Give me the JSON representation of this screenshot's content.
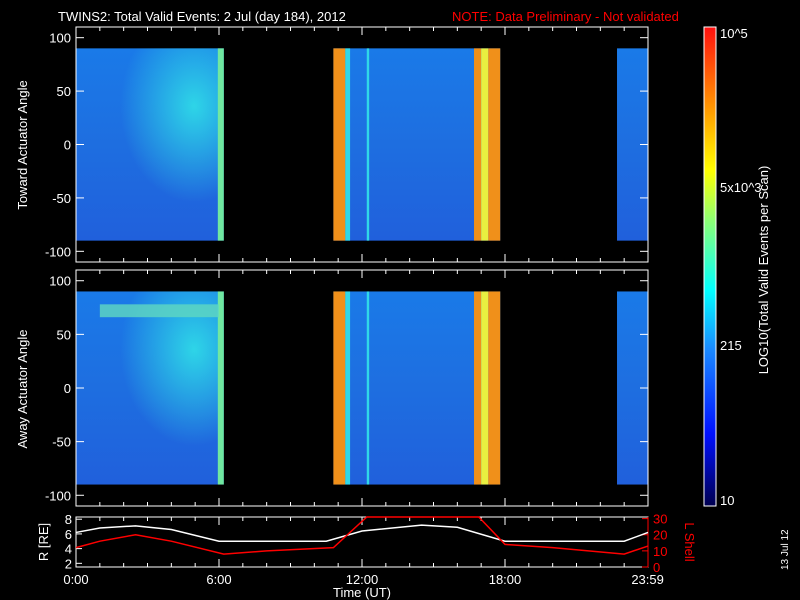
{
  "chart_data": {
    "type": "heatmap",
    "title": "TWINS2: Total Valid Events:  2 Jul (day 184), 2012",
    "note": "NOTE: Data Preliminary - Not validated",
    "panels": [
      {
        "ylabel": "Toward Actuator Angle",
        "ylim": [
          -110,
          110
        ],
        "yticks": [
          "100",
          "50",
          "0",
          "-50",
          "-100"
        ]
      },
      {
        "ylabel": "Away Actuator Angle",
        "ylim": [
          -110,
          110
        ],
        "yticks": [
          "100",
          "50",
          "0",
          "-50",
          "-100"
        ]
      }
    ],
    "data_intervals_hours": [
      [
        0,
        6.2
      ],
      [
        10.8,
        17.8
      ],
      [
        22.7,
        24
      ]
    ],
    "bright_bands_hours": [
      {
        "start": 10.8,
        "end": 11.3,
        "level": "orange"
      },
      {
        "start": 11.3,
        "end": 11.5,
        "level": "cyan"
      },
      {
        "start": 12.2,
        "end": 12.3,
        "level": "cyan"
      },
      {
        "start": 16.7,
        "end": 17.0,
        "level": "orange"
      },
      {
        "start": 17.0,
        "end": 17.3,
        "level": "yellow"
      },
      {
        "start": 17.3,
        "end": 17.8,
        "level": "orange"
      }
    ],
    "colorbar": {
      "label": "LOG10(Total Valid Events per Scan)",
      "ticks": [
        "10",
        "215",
        "5x10^3",
        "10^5"
      ],
      "range": [
        10,
        100000
      ]
    },
    "xlabel": "Time (UT)",
    "xticks": [
      "0:00",
      "6:00",
      "12:00",
      "18:00",
      "23:59"
    ],
    "orbit": {
      "ylabel_left": "R [RE]",
      "ylabel_right": "L Shell",
      "yticks_left": [
        "2",
        "4",
        "6",
        "8"
      ],
      "yticks_right": [
        "0",
        "10",
        "20",
        "30"
      ],
      "ylim_left": [
        1.5,
        8.3
      ],
      "ylim_right": [
        0,
        31
      ],
      "hours": [
        0,
        1,
        2.5,
        4,
        6,
        8,
        10.5,
        12,
        14.5,
        16,
        18,
        20,
        23,
        24
      ],
      "R": [
        6.2,
        6.8,
        7.1,
        6.6,
        5.0,
        5.0,
        5.0,
        6.4,
        7.2,
        6.9,
        5.0,
        5.0,
        5.0,
        6.2
      ],
      "hoursL": [
        0,
        1,
        2.5,
        4,
        6.2,
        8,
        10.8,
        12.2,
        16.9,
        18,
        20,
        23,
        24
      ],
      "L": [
        12,
        16,
        20,
        16,
        8,
        10,
        12,
        31,
        31,
        14,
        12,
        8,
        13
      ]
    },
    "date_stamp": "13 Jul 12"
  }
}
